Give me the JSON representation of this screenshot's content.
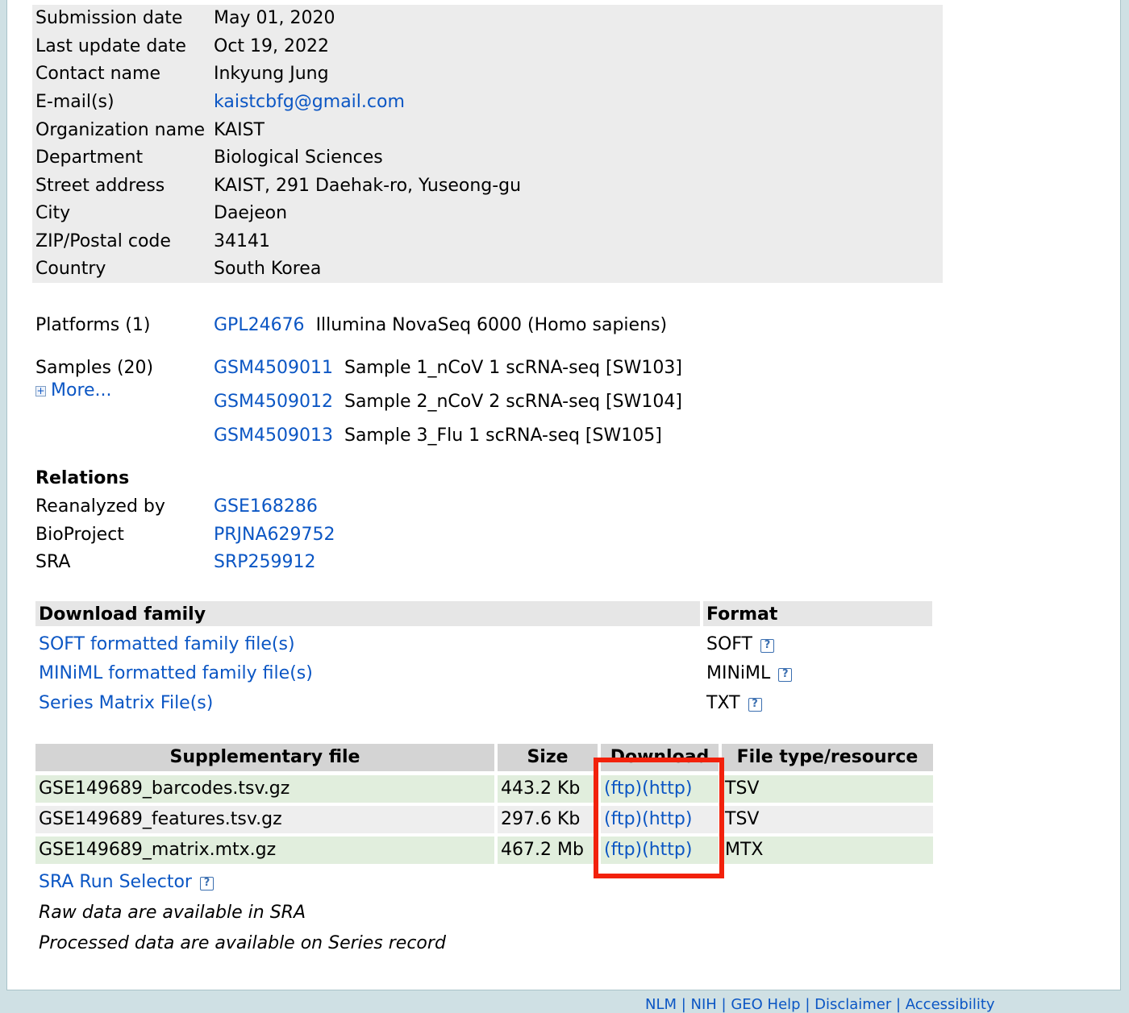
{
  "contact": {
    "rows": [
      {
        "label": "Submission date",
        "value": "May 01, 2020"
      },
      {
        "label": "Last update date",
        "value": "Oct 19, 2022"
      },
      {
        "label": "Contact name",
        "value": "Inkyung Jung"
      },
      {
        "label": "E-mail(s)",
        "value": "kaistcbfg@gmail.com"
      },
      {
        "label": "Organization name",
        "value": "KAIST"
      },
      {
        "label": "Department",
        "value": "Biological Sciences"
      },
      {
        "label": "Street address",
        "value": "KAIST, 291 Daehak-ro, Yuseong-gu"
      },
      {
        "label": "City",
        "value": "Daejeon"
      },
      {
        "label": "ZIP/Postal code",
        "value": "34141"
      },
      {
        "label": "Country",
        "value": "South Korea"
      }
    ]
  },
  "platforms": {
    "label": "Platforms (1)",
    "id": "GPL24676",
    "desc": "Illumina NovaSeq 6000 (Homo sapiens)"
  },
  "samples": {
    "label": "Samples (20)",
    "more": "More...",
    "items": [
      {
        "id": "GSM4509011",
        "desc": "Sample 1_nCoV 1 scRNA-seq [SW103]"
      },
      {
        "id": "GSM4509012",
        "desc": "Sample 2_nCoV 2 scRNA-seq [SW104]"
      },
      {
        "id": "GSM4509013",
        "desc": "Sample 3_Flu 1 scRNA-seq [SW105]"
      }
    ]
  },
  "relations": {
    "title": "Relations",
    "rows": [
      {
        "label": "Reanalyzed by",
        "value": "GSE168286"
      },
      {
        "label": "BioProject",
        "value": "PRJNA629752"
      },
      {
        "label": "SRA",
        "value": "SRP259912"
      }
    ]
  },
  "download_family": {
    "header": "Download family",
    "format_header": "Format",
    "help_glyph": "?",
    "rows": [
      {
        "label": "SOFT formatted family file(s)",
        "format": "SOFT"
      },
      {
        "label": "MINiML formatted family file(s)",
        "format": "MINiML"
      },
      {
        "label": "Series Matrix File(s)",
        "format": "TXT"
      }
    ]
  },
  "supplementary": {
    "headers": {
      "file": "Supplementary file",
      "size": "Size",
      "download": "Download",
      "type": "File type/resource"
    },
    "ftp_label": "(ftp)",
    "http_label": "(http)",
    "rows": [
      {
        "file": "GSE149689_barcodes.tsv.gz",
        "size": "443.2 Kb",
        "type": "TSV"
      },
      {
        "file": "GSE149689_features.tsv.gz",
        "size": "297.6 Kb",
        "type": "TSV"
      },
      {
        "file": "GSE149689_matrix.mtx.gz",
        "size": "467.2 Mb",
        "type": "MTX"
      }
    ],
    "sra_selector": "SRA Run Selector",
    "note_raw": "Raw data are available in SRA",
    "note_processed": "Processed data are available on Series record"
  },
  "footer": {
    "links": "NLM | NIH | GEO Help | Disclaimer | Accessibility"
  },
  "colors": {
    "link": "#0b56c4",
    "highlight_box": "#f2210b",
    "row_green": "#e1eedd"
  }
}
